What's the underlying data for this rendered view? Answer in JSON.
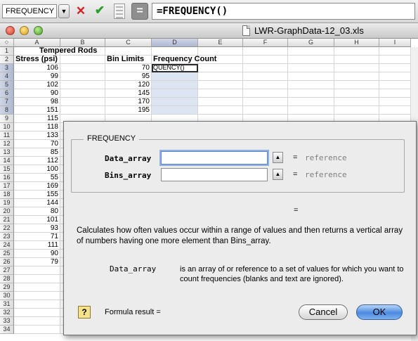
{
  "formula_bar": {
    "name_box": "FREQUENCY",
    "formula": "=FREQUENCY()",
    "cancel_glyph": "✕",
    "enter_glyph": "✔",
    "equals_glyph": "="
  },
  "window": {
    "title": "LWR-GraphData-12_03.xls"
  },
  "sheet": {
    "corner": "◇",
    "columns": [
      "A",
      "B",
      "C",
      "D",
      "E",
      "F",
      "G",
      "H",
      "I"
    ],
    "rows": [
      "1",
      "2",
      "3",
      "4",
      "5",
      "6",
      "7",
      "8",
      "9",
      "10",
      "11",
      "12",
      "13",
      "14",
      "15",
      "16",
      "17",
      "18",
      "19",
      "20",
      "21",
      "22",
      "23",
      "24",
      "25",
      "26",
      "27",
      "28",
      "29",
      "30",
      "31",
      "32",
      "33",
      "34"
    ],
    "title_cell": "Tempered Rods",
    "headers": {
      "stress": "Stress (psi)",
      "bins": "Bin Limits",
      "frequency": "Frequency Count"
    },
    "stress_values": [
      "106",
      "99",
      "102",
      "90",
      "98",
      "151",
      "115",
      "118",
      "133",
      "70",
      "85",
      "112",
      "100",
      "55",
      "169",
      "155",
      "144",
      "80",
      "101",
      "93",
      "71",
      "111",
      "90",
      "79"
    ],
    "bin_values": [
      "70",
      "95",
      "120",
      "145",
      "170",
      "195"
    ],
    "active_cell_text": "QUENCY()"
  },
  "dialog": {
    "function_name": "FREQUENCY",
    "args": [
      {
        "label": "Data_array",
        "value": "",
        "hint": "reference"
      },
      {
        "label": "Bins_array",
        "value": "",
        "hint": "reference"
      }
    ],
    "eq": "=",
    "collapse_glyph": "▲",
    "result_eq": "=",
    "description": "Calculates how often values occur within a range of values and then returns a vertical array of numbers having one more element than Bins_array.",
    "arg_help_name": "Data_array",
    "arg_help_text": "is an array of or reference to a set of values for which you want to count frequencies (blanks and text are ignored).",
    "help_glyph": "?",
    "formula_result": "Formula result =",
    "cancel": "Cancel",
    "ok": "OK"
  }
}
